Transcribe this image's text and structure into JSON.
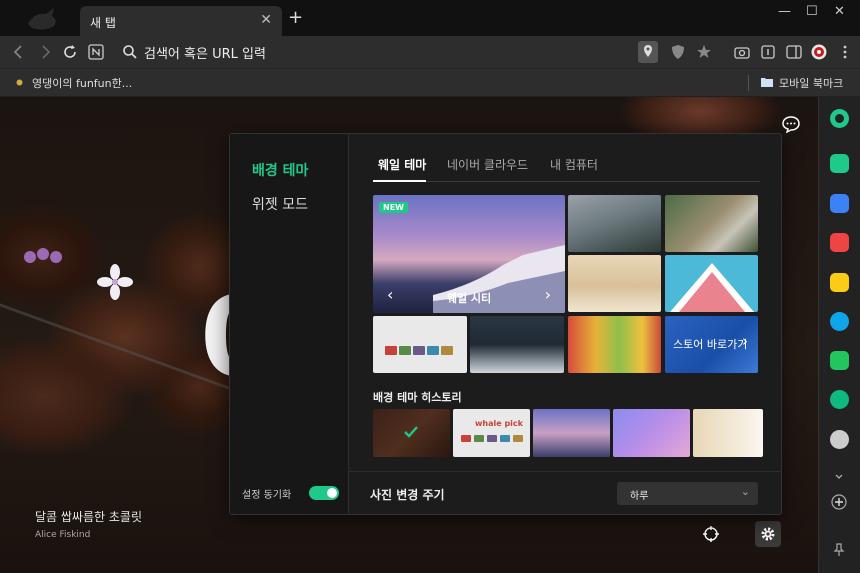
{
  "browser": {
    "tab_title": "새 탭",
    "tab_close": "✕",
    "new_tab": "+",
    "window_controls": {
      "minimize": "—",
      "maximize": "☐",
      "close": "✕"
    },
    "url_placeholder": "검색어 혹은 URL 입력",
    "bookmarks": {
      "left_item": "영댕이의 funfun한...",
      "mobile": "모바일 북마크"
    }
  },
  "page": {
    "clock_partial": "0",
    "caption": "달콤 쌉싸름한 초콜릿",
    "credit": "Alice Fiskind"
  },
  "panel": {
    "modes": [
      "배경 테마",
      "위젯 모드"
    ],
    "active_mode_color": "#1ec98a",
    "tabs": [
      "웨일 테마",
      "네이버 클라우드",
      "내 컴퓨터"
    ],
    "featured": {
      "badge": "NEW",
      "name": "웨일 시티"
    },
    "store_tile": "스토어 바로가기",
    "whale_pick": "whale pick",
    "history_title": "배경 테마 히스토리",
    "sync_label": "설정 동기화",
    "sync_on": true,
    "cycle_label": "사진 변경 주기",
    "cycle_value": "하루"
  },
  "icons": {
    "featured_prev": "‹",
    "featured_next": "›",
    "store_arrow": "›",
    "select_chevron": "⌄"
  },
  "colors": {
    "accent": "#1ec98a",
    "panel_bg": "#1c1c1c",
    "store_blue": "#2366c8"
  }
}
